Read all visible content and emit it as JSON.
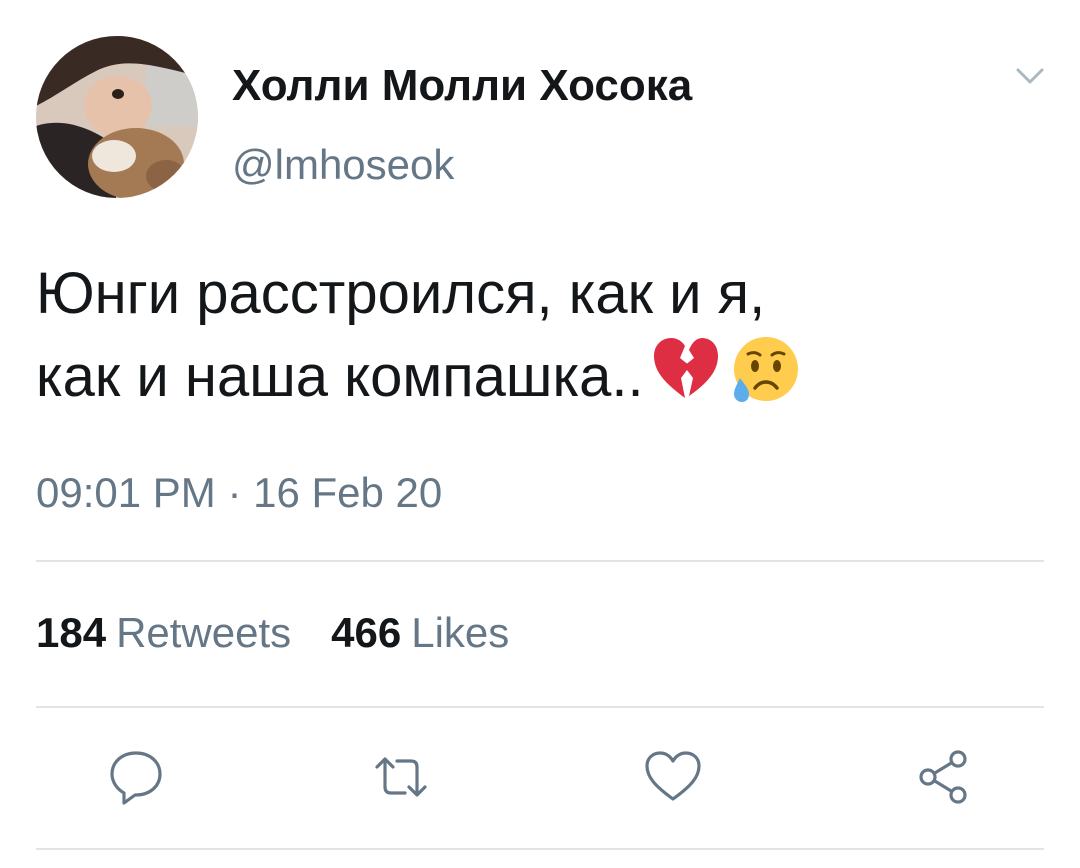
{
  "tweet": {
    "author": {
      "display_name": "Холли Молли Хосока",
      "handle": "@lmhoseok"
    },
    "text_line1": "Юнги расстроился, как и я,",
    "text_line2": "как и наша компашка..",
    "emojis": [
      "broken-heart-emoji",
      "sad-but-relieved-face-emoji"
    ],
    "timestamp": "09:01 PM · 16 Feb 20",
    "stats": {
      "retweets_count": "184",
      "retweets_label": "Retweets",
      "likes_count": "466",
      "likes_label": "Likes"
    },
    "actions": [
      "reply-icon",
      "retweet-icon",
      "like-icon",
      "share-icon"
    ]
  },
  "colors": {
    "text_primary": "#14171a",
    "text_secondary": "#657786",
    "divider": "#dfe4e8",
    "icon": "#657786"
  }
}
